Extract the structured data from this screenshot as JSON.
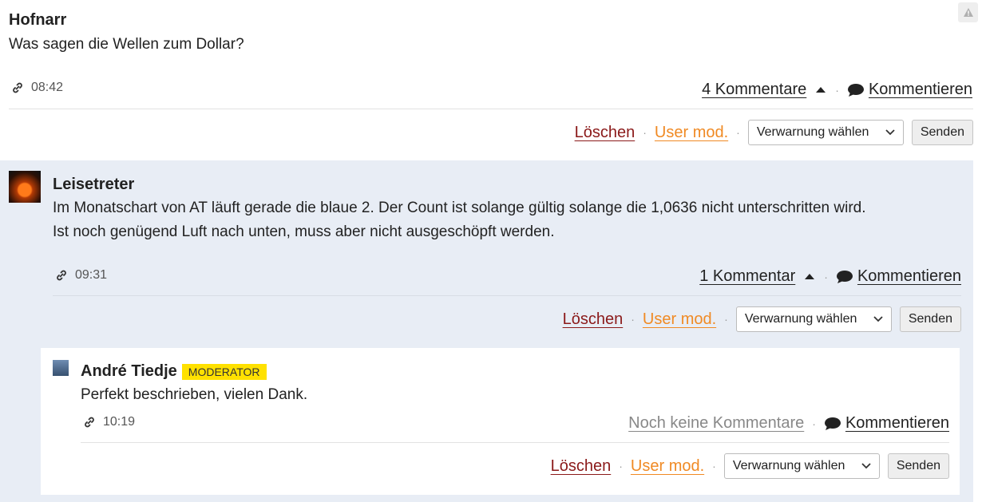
{
  "comments": [
    {
      "author": "Hofnarr",
      "text": "Was sagen die Wellen zum Dollar?",
      "time": "08:42",
      "count_label": "4 Kommentare",
      "reply_label": "Kommentieren"
    },
    {
      "author": "Leisetreter",
      "text_line1": "Im Monatschart von AT läuft gerade die blaue 2. Der Count ist solange gültig solange die 1,0636 nicht unterschritten wird.",
      "text_line2": "Ist noch genügend Luft nach unten, muss aber nicht ausgeschöpft werden.",
      "time": "09:31",
      "count_label": "1 Kommentar",
      "reply_label": "Kommentieren"
    },
    {
      "author": "André Tiedje",
      "badge": "MODERATOR",
      "text": "Perfekt beschrieben, vielen Dank.",
      "time": "10:19",
      "count_label": "Noch keine Kommentare",
      "reply_label": "Kommentieren"
    }
  ],
  "moderation": {
    "delete_label": "Löschen",
    "usermod_label": "User mod.",
    "warning_select": "Verwarnung wählen",
    "send_label": "Senden"
  },
  "separator": "·",
  "colors": {
    "delete": "#8b1a1a",
    "usermod": "#f08a24",
    "nested_bg": "#e8edf5",
    "badge": "#ffe100"
  },
  "icons": [
    "link-icon",
    "caret-up-icon",
    "speech-bubble-icon",
    "chevron-down-icon",
    "warning-icon"
  ]
}
